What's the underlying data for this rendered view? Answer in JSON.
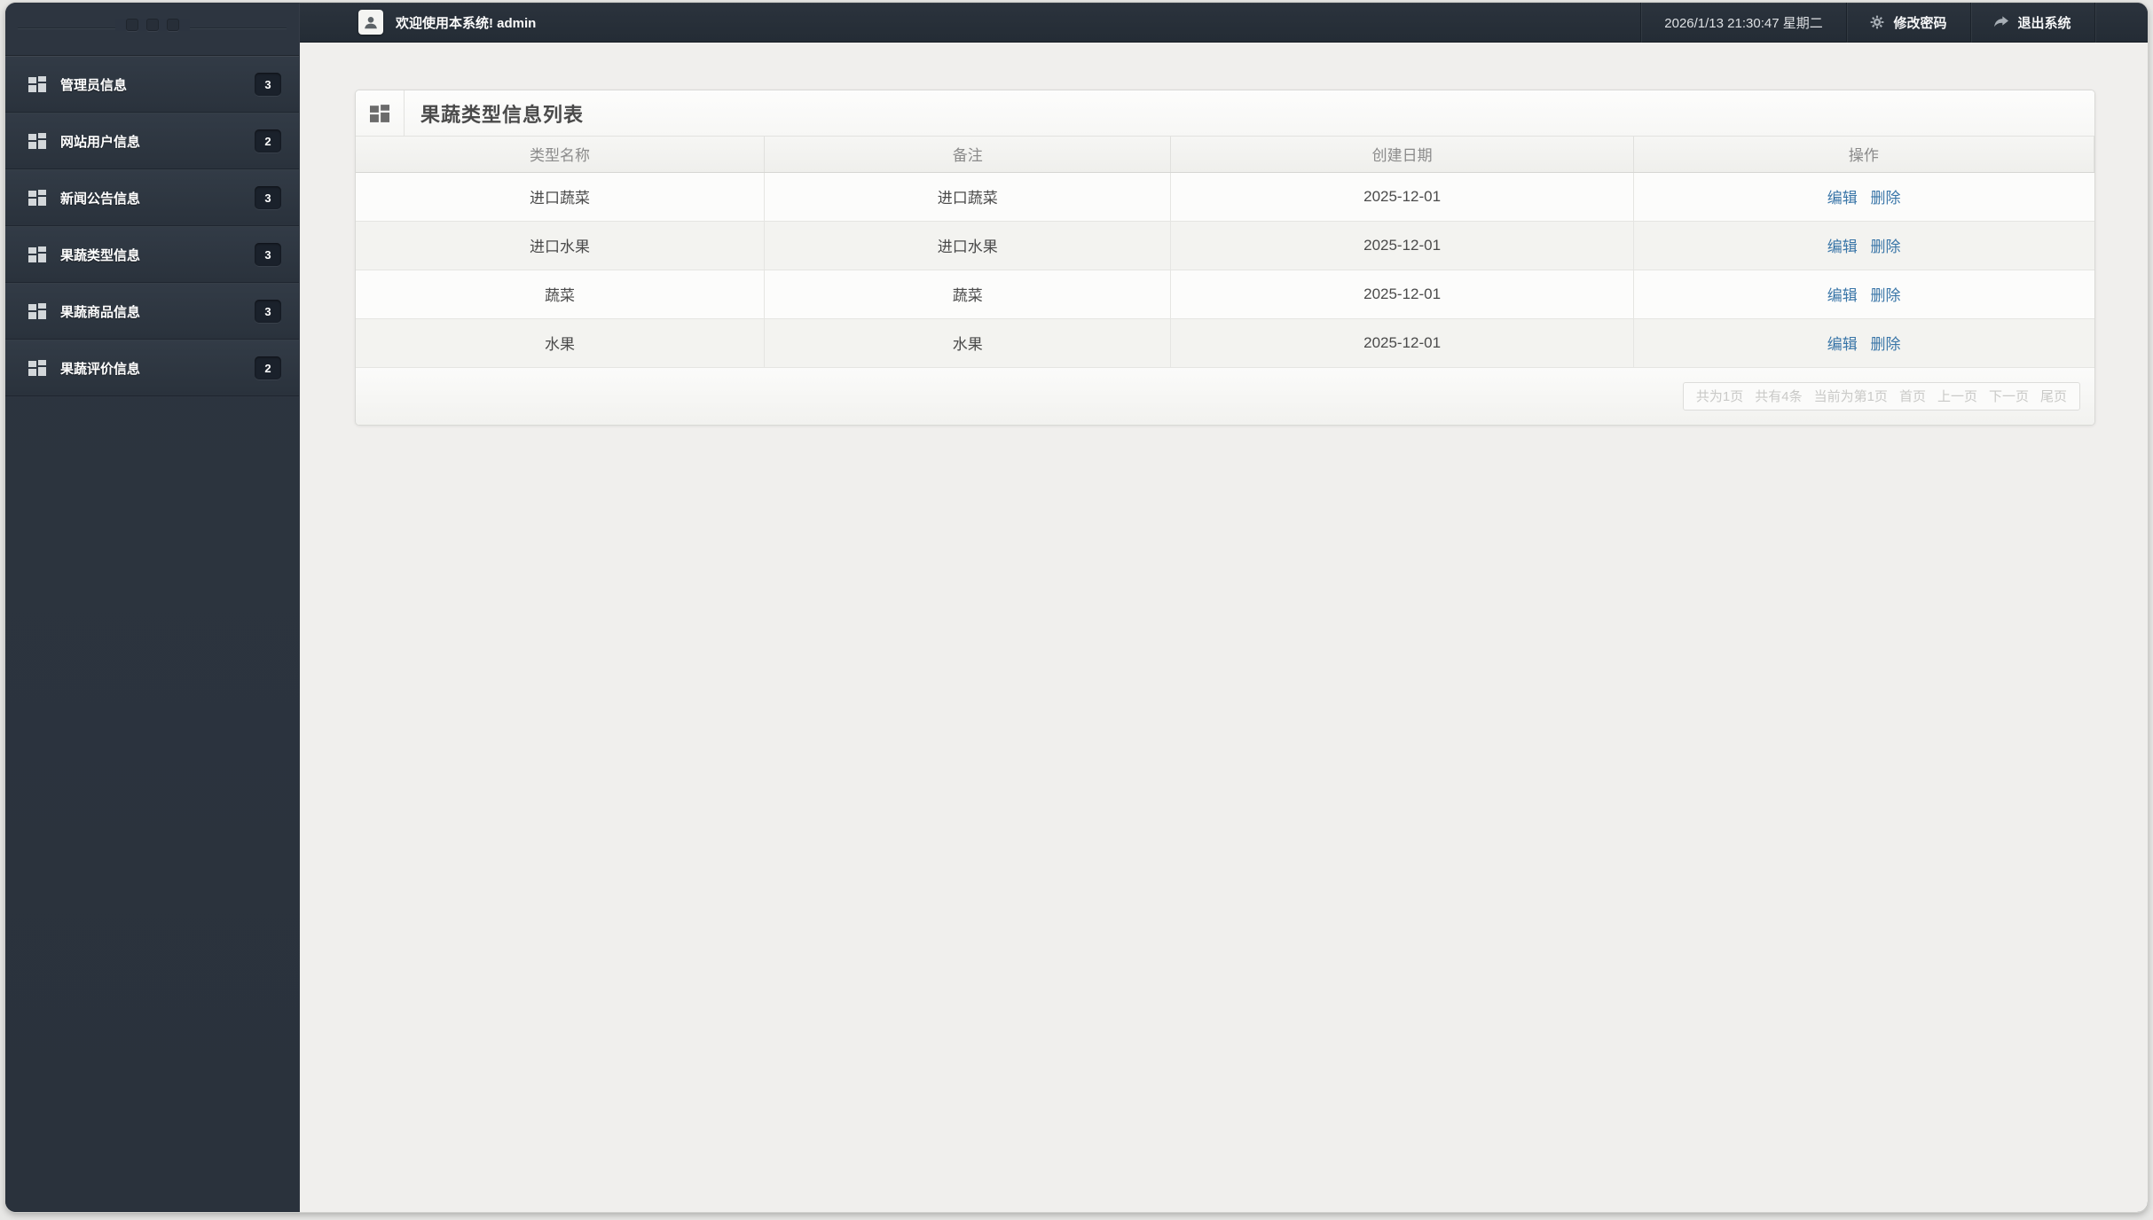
{
  "topbar": {
    "welcome": "欢迎使用本系统! admin",
    "datetime": "2026/1/13 21:30:47 星期二",
    "change_password": "修改密码",
    "logout": "退出系统"
  },
  "sidebar": {
    "items": [
      {
        "label": "管理员信息",
        "badge": "3"
      },
      {
        "label": "网站用户信息",
        "badge": "2"
      },
      {
        "label": "新闻公告信息",
        "badge": "3"
      },
      {
        "label": "果蔬类型信息",
        "badge": "3"
      },
      {
        "label": "果蔬商品信息",
        "badge": "3"
      },
      {
        "label": "果蔬评价信息",
        "badge": "2"
      }
    ]
  },
  "panel": {
    "title": "果蔬类型信息列表",
    "table": {
      "columns": [
        "类型名称",
        "备注",
        "创建日期",
        "操作"
      ],
      "edit_label": "编辑",
      "delete_label": "删除",
      "rows": [
        {
          "name": "进口蔬菜",
          "note": "进口蔬菜",
          "date": "2025-12-01"
        },
        {
          "name": "进口水果",
          "note": "进口水果",
          "date": "2025-12-01"
        },
        {
          "name": "蔬菜",
          "note": "蔬菜",
          "date": "2025-12-01"
        },
        {
          "name": "水果",
          "note": "水果",
          "date": "2025-12-01"
        }
      ]
    },
    "pagination": {
      "total_pages": "共为1页",
      "total_items": "共有4条",
      "current": "当前为第1页",
      "first": "首页",
      "prev": "上一页",
      "next": "下一页",
      "last": "尾页"
    }
  },
  "icons": {
    "sidebar_item": "grid-icon",
    "panel_header": "grid-icon",
    "topbar_user": "user-silhouette-icon",
    "change_password": "gear-icon",
    "logout": "curved-arrow-right-icon"
  },
  "colors": {
    "sidebar_bg": "#2b333d",
    "topbar_bg": "#272f38",
    "badge_bg": "#1a212b",
    "content_bg": "#f0efed",
    "link_blue": "#3a76a8",
    "pagination_text": "#c9c9c7"
  }
}
